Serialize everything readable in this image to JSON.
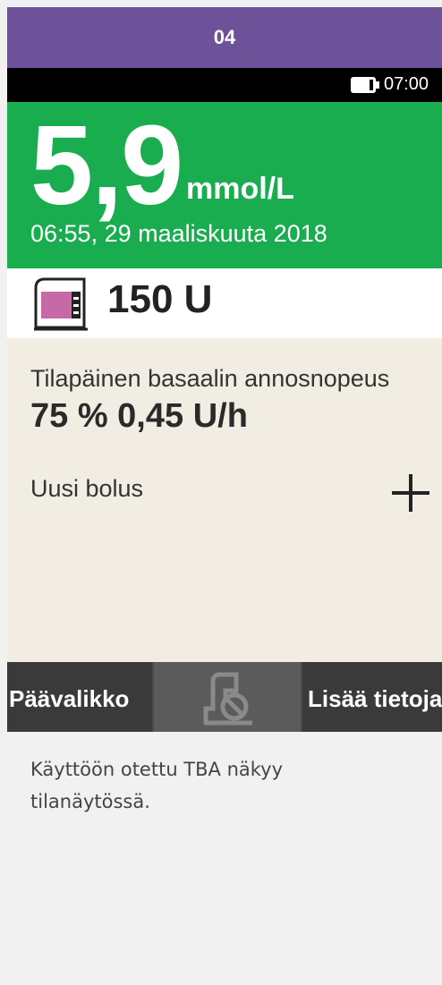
{
  "step": {
    "number": "04"
  },
  "status_bar": {
    "time": "07:00",
    "battery_icon": "battery-icon"
  },
  "glucose": {
    "value": "5,9",
    "unit": "mmol/L",
    "timestamp": "06:55, 29 maaliskuuta 2018",
    "color": "#1aad4f"
  },
  "reservoir": {
    "amount": "150 U",
    "icon": "insulin-cartridge-icon",
    "color": "#c56aa7"
  },
  "temporary_basal": {
    "label": "Tilapäinen basaalin annosnopeus",
    "value": "75 % 0,45 U/h"
  },
  "bolus": {
    "label": "Uusi bolus",
    "icon": "plus-icon"
  },
  "softkeys": {
    "left": "Päävalikko",
    "middle_icon": "delivery-stopped-icon",
    "right": "Lisää tietoja"
  },
  "caption": "Käyttöön otettu TBA näkyy tilanäytössä.",
  "colors": {
    "header": "#6e5299",
    "panel": "#f1ede3",
    "softkey": "#3a3a3a"
  }
}
